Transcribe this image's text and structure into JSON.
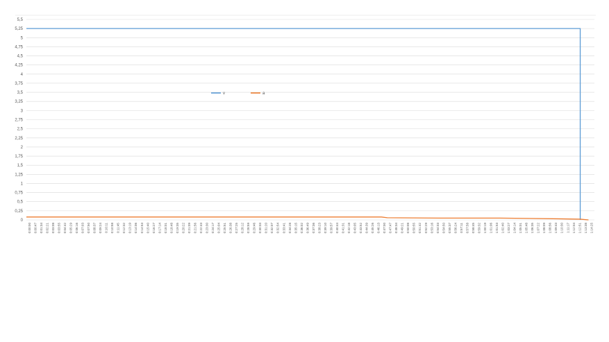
{
  "chart_data": {
    "type": "line",
    "title": "",
    "xlabel": "",
    "ylabel": "",
    "ylim": [
      0,
      5.5
    ],
    "y_ticks": [
      "0",
      "0,25",
      "0,5",
      "0,75",
      "1",
      "1,25",
      "1,5",
      "1,75",
      "2",
      "2,25",
      "2,5",
      "2,75",
      "3",
      "3,25",
      "3,5",
      "3,75",
      "4",
      "4,25",
      "4,5",
      "4,75",
      "5",
      "5,25",
      "5,5"
    ],
    "x_ticks": [
      "0:00:00",
      "0:00:47",
      "0:01:34",
      "0:02:21",
      "0:03:08",
      "0:03:55",
      "0:04:42",
      "0:05:29",
      "0:06:16",
      "0:07:03",
      "0:07:50",
      "0:08:37",
      "0:09:24",
      "0:10:11",
      "0:10:58",
      "0:11:45",
      "0:12:32",
      "0:13:19",
      "0:14:06",
      "0:14:53",
      "0:15:40",
      "0:16:27",
      "0:17:14",
      "0:18:01",
      "0:18:48",
      "0:19:35",
      "0:20:22",
      "0:21:09",
      "0:21:56",
      "0:22:43",
      "0:23:30",
      "0:24:17",
      "0:25:04",
      "0:25:51",
      "0:26:38",
      "0:27:25",
      "0:28:12",
      "0:28:59",
      "0:29:46",
      "0:30:33",
      "0:31:20",
      "0:32:07",
      "0:32:54",
      "0:33:41",
      "0:34:28",
      "0:35:15",
      "0:36:02",
      "0:36:49",
      "0:37:36",
      "0:38:23",
      "0:39:10",
      "0:39:57",
      "0:40:44",
      "0:41:31",
      "0:42:18",
      "0:43:05",
      "0:43:52",
      "0:44:39",
      "0:45:26",
      "0:46:13",
      "0:47:00",
      "0:47:47",
      "0:48:34",
      "0:49:21",
      "0:50:08",
      "0:50:55",
      "0:51:42",
      "0:52:29",
      "0:53:16",
      "0:54:03",
      "0:54:50",
      "0:55:37",
      "0:56:24",
      "0:57:11",
      "0:57:58",
      "0:58:45",
      "0:59:32",
      "1:00:19",
      "1:01:06",
      "1:01:53",
      "1:02:40",
      "1:03:27",
      "1:04:14",
      "1:05:01",
      "1:05:48",
      "1:06:35",
      "1:07:22",
      "1:08:09",
      "1:08:56",
      "1:09:43",
      "1:10:30",
      "1:11:17",
      "1:12:04",
      "1:12:51",
      "1:13:38",
      "1:14:25"
    ],
    "series": [
      {
        "name": "v",
        "color": "#5b9bd5",
        "points": [
          [
            0,
            5.25
          ],
          [
            93.6,
            5.25
          ],
          [
            93.6,
            0
          ]
        ]
      },
      {
        "name": "a",
        "color": "#ed7d31",
        "points": [
          [
            0,
            0.08
          ],
          [
            60,
            0.08
          ],
          [
            61,
            0.06
          ],
          [
            70,
            0.05
          ],
          [
            80,
            0.05
          ],
          [
            90,
            0.03
          ],
          [
            93.6,
            0.02
          ],
          [
            95,
            0.0
          ]
        ]
      }
    ],
    "grid": true,
    "legend": "center"
  }
}
